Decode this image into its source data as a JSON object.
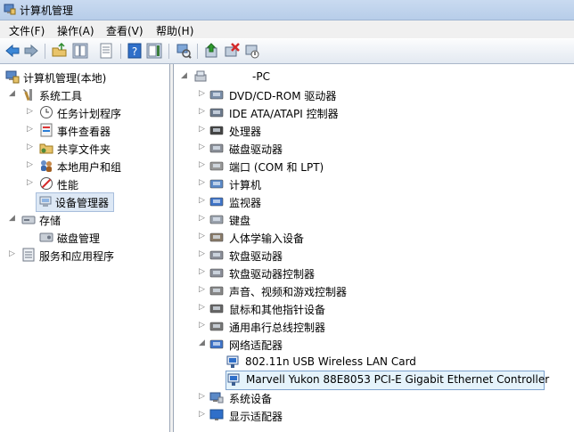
{
  "window": {
    "title": "计算机管理"
  },
  "menu": [
    "文件(F)",
    "操作(A)",
    "查看(V)",
    "帮助(H)"
  ],
  "toolbar": [
    "back-icon",
    "forward-icon",
    "up-folder-icon",
    "show-hide-tree-icon",
    "properties-icon",
    "help-icon",
    "action-pane-icon",
    "scan-hardware-icon",
    "update-driver-icon",
    "uninstall-icon",
    "disable-icon"
  ],
  "left_tree": {
    "root": "计算机管理(本地)",
    "system_tools": "系统工具",
    "task_scheduler": "任务计划程序",
    "event_viewer": "事件查看器",
    "shared_folders": "共享文件夹",
    "local_users": "本地用户和组",
    "performance": "性能",
    "device_manager": "设备管理器",
    "storage": "存储",
    "disk_management": "磁盘管理",
    "services_apps": "服务和应用程序"
  },
  "right_tree": {
    "root": "-PC",
    "devices": [
      "DVD/CD-ROM 驱动器",
      "IDE ATA/ATAPI 控制器",
      "处理器",
      "磁盘驱动器",
      "端口 (COM 和 LPT)",
      "计算机",
      "监视器",
      "键盘",
      "人体学输入设备",
      "软盘驱动器",
      "软盘驱动器控制器",
      "声音、视频和游戏控制器",
      "鼠标和其他指针设备",
      "通用串行总线控制器",
      "网络适配器"
    ],
    "network_children": [
      "802.11n USB Wireless LAN Card",
      "Marvell Yukon 88E8053 PCI-E Gigabit Ethernet Controller"
    ],
    "tail": [
      "系统设备",
      "显示适配器"
    ]
  }
}
